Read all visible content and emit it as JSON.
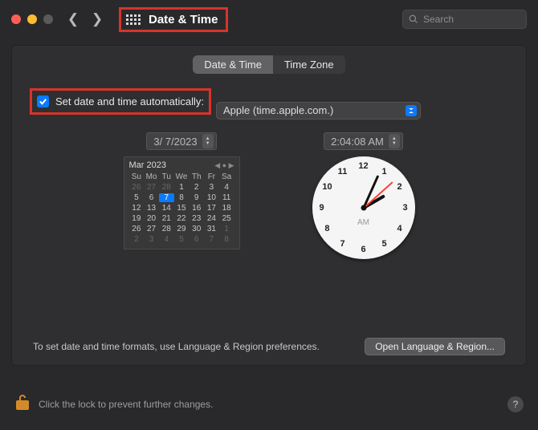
{
  "header": {
    "title": "Date & Time",
    "search_placeholder": "Search"
  },
  "tabs": {
    "active": "Date & Time",
    "inactive": "Time Zone"
  },
  "auto": {
    "label": "Set date and time automatically:",
    "server": "Apple (time.apple.com.)"
  },
  "date_field": "3/  7/2023",
  "time_field": "2:04:08 AM",
  "calendar": {
    "title": "Mar 2023",
    "dow": [
      "Su",
      "Mo",
      "Tu",
      "We",
      "Th",
      "Fr",
      "Sa"
    ],
    "cells": [
      {
        "d": "26",
        "dim": true
      },
      {
        "d": "27",
        "dim": true
      },
      {
        "d": "28",
        "dim": true
      },
      {
        "d": "1"
      },
      {
        "d": "2"
      },
      {
        "d": "3"
      },
      {
        "d": "4"
      },
      {
        "d": "5"
      },
      {
        "d": "6"
      },
      {
        "d": "7",
        "sel": true
      },
      {
        "d": "8"
      },
      {
        "d": "9"
      },
      {
        "d": "10"
      },
      {
        "d": "11"
      },
      {
        "d": "12"
      },
      {
        "d": "13"
      },
      {
        "d": "14"
      },
      {
        "d": "15"
      },
      {
        "d": "16"
      },
      {
        "d": "17"
      },
      {
        "d": "18"
      },
      {
        "d": "19"
      },
      {
        "d": "20"
      },
      {
        "d": "21"
      },
      {
        "d": "22"
      },
      {
        "d": "23"
      },
      {
        "d": "24"
      },
      {
        "d": "25"
      },
      {
        "d": "26"
      },
      {
        "d": "27"
      },
      {
        "d": "28"
      },
      {
        "d": "29"
      },
      {
        "d": "30"
      },
      {
        "d": "31"
      },
      {
        "d": "1",
        "dim": true
      },
      {
        "d": "2",
        "dim": true
      },
      {
        "d": "3",
        "dim": true
      },
      {
        "d": "4",
        "dim": true
      },
      {
        "d": "5",
        "dim": true
      },
      {
        "d": "6",
        "dim": true
      },
      {
        "d": "7",
        "dim": true
      },
      {
        "d": "8",
        "dim": true
      }
    ]
  },
  "clock": {
    "ampm": "AM",
    "numbers": [
      "12",
      "1",
      "2",
      "3",
      "4",
      "5",
      "6",
      "7",
      "8",
      "9",
      "10",
      "11"
    ]
  },
  "hint": "To set date and time formats, use Language & Region preferences.",
  "open_btn": "Open Language & Region...",
  "lock_text": "Click the lock to prevent further changes.",
  "help": "?"
}
